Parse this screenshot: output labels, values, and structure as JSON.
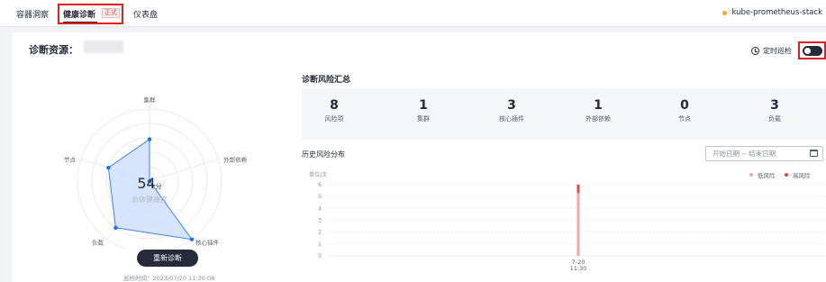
{
  "tabs": [
    {
      "label": "容器洞察"
    },
    {
      "label": "健康诊断",
      "badge": "正式",
      "active": true
    },
    {
      "label": "仪表盘"
    }
  ],
  "cluster": {
    "name": "kube-prometheus-stack",
    "status_color": "#f5a623"
  },
  "panel": {
    "title": "诊断资源：",
    "timer_label": "定时巡检",
    "timer_enabled": true
  },
  "radar": {
    "axes": [
      "集群",
      "外部依赖",
      "核心插件",
      "负载",
      "节点"
    ],
    "values": [
      58,
      0,
      100,
      80,
      60
    ],
    "score": "54",
    "score_unit": "分",
    "score_label": "总体健康度",
    "button_label": "重新诊断",
    "patrol_time": "巡检时间：2023/07/20 11:30:08"
  },
  "summary": {
    "title": "诊断风险汇总",
    "items": [
      {
        "value": "8",
        "label": "风险项"
      },
      {
        "value": "1",
        "label": "集群"
      },
      {
        "value": "3",
        "label": "核心插件"
      },
      {
        "value": "1",
        "label": "外部依赖"
      },
      {
        "value": "0",
        "label": "节点"
      },
      {
        "value": "3",
        "label": "负载"
      }
    ]
  },
  "history": {
    "title": "历史风险分布",
    "date_placeholder": "开始日期 -- 结束日期",
    "legend": [
      {
        "label": "低风险",
        "color": "#f5a5a5"
      },
      {
        "label": "高风险",
        "color": "#e54545"
      }
    ]
  },
  "chart_data": {
    "type": "bar",
    "ylabel": "单位/次",
    "yticks": [
      0,
      1,
      2,
      3,
      4,
      5,
      6
    ],
    "ylim": [
      0,
      6
    ],
    "categories": [
      "7-20\n11:30"
    ],
    "x_label_lines": [
      "7-20",
      "11:30"
    ],
    "series": [
      {
        "name": "低风险",
        "values": [
          5.3
        ],
        "color": "#f5a5a5"
      },
      {
        "name": "高风险",
        "values": [
          0.7
        ],
        "color": "#e54545"
      }
    ]
  },
  "colors": {
    "accent": "#252b3a",
    "radar_fill": "#cfe0fb",
    "radar_stroke": "#3b82f6",
    "highlight": "#e02020"
  }
}
